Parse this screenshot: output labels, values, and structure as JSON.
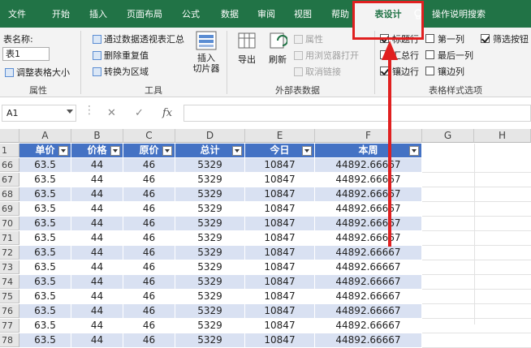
{
  "tabs": [
    "文件",
    "开始",
    "插入",
    "页面布局",
    "公式",
    "数据",
    "审阅",
    "视图",
    "帮助"
  ],
  "active_tab": "表设计",
  "tell_me": "操作说明搜索",
  "ribbon": {
    "properties": {
      "name_label": "表名称:",
      "name_value": "表1",
      "resize": "调整表格大小",
      "group": "属性"
    },
    "tools": {
      "pivot": "通过数据透视表汇总",
      "dedupe": "删除重复值",
      "convert": "转换为区域",
      "slicer": "插入\n切片器",
      "group": "工具"
    },
    "external": {
      "export": "导出",
      "refresh": "刷新",
      "properties": "属性",
      "open_browser": "用浏览器打开",
      "unlink": "取消链接",
      "group": "外部表数据"
    },
    "style_options": {
      "items": [
        {
          "label": "标题行",
          "checked": true
        },
        {
          "label": "第一列",
          "checked": false
        },
        {
          "label": "筛选按钮",
          "checked": true
        },
        {
          "label": "汇总行",
          "checked": false
        },
        {
          "label": "最后一列",
          "checked": false
        },
        {
          "label": "镶边行",
          "checked": true
        },
        {
          "label": "镶边列",
          "checked": false
        }
      ],
      "group": "表格样式选项"
    }
  },
  "formula_bar": {
    "name_box": "A1",
    "cancel": "✕",
    "enter": "✓",
    "fx": "fx",
    "formula": ""
  },
  "columns": [
    "A",
    "B",
    "C",
    "D",
    "E",
    "F",
    "G",
    "H"
  ],
  "headers": [
    "单价",
    "价格",
    "原价",
    "总计",
    "今日",
    "本周"
  ],
  "header_row_number": "1",
  "rows": [
    {
      "n": "66",
      "v": [
        "63.5",
        "44",
        "46",
        "5329",
        "10847",
        "44892.66667"
      ]
    },
    {
      "n": "67",
      "v": [
        "63.5",
        "44",
        "46",
        "5329",
        "10847",
        "44892.66667"
      ]
    },
    {
      "n": "68",
      "v": [
        "63.5",
        "44",
        "46",
        "5329",
        "10847",
        "44892.66667"
      ]
    },
    {
      "n": "69",
      "v": [
        "63.5",
        "44",
        "46",
        "5329",
        "10847",
        "44892.66667"
      ]
    },
    {
      "n": "70",
      "v": [
        "63.5",
        "44",
        "46",
        "5329",
        "10847",
        "44892.66667"
      ]
    },
    {
      "n": "71",
      "v": [
        "63.5",
        "44",
        "46",
        "5329",
        "10847",
        "44892.66667"
      ]
    },
    {
      "n": "72",
      "v": [
        "63.5",
        "44",
        "46",
        "5329",
        "10847",
        "44892.66667"
      ]
    },
    {
      "n": "73",
      "v": [
        "63.5",
        "44",
        "46",
        "5329",
        "10847",
        "44892.66667"
      ]
    },
    {
      "n": "74",
      "v": [
        "63.5",
        "44",
        "46",
        "5329",
        "10847",
        "44892.66667"
      ]
    },
    {
      "n": "75",
      "v": [
        "63.5",
        "44",
        "46",
        "5329",
        "10847",
        "44892.66667"
      ]
    },
    {
      "n": "76",
      "v": [
        "63.5",
        "44",
        "46",
        "5329",
        "10847",
        "44892.66667"
      ]
    },
    {
      "n": "77",
      "v": [
        "63.5",
        "44",
        "46",
        "5329",
        "10847",
        "44892.66667"
      ]
    },
    {
      "n": "78",
      "v": [
        "63.5",
        "44",
        "46",
        "5329",
        "10847",
        "44892.66667"
      ]
    }
  ],
  "colors": {
    "excel_green": "#217346",
    "table_header": "#4472c4",
    "band_row": "#d9e1f2",
    "annotation_red": "#e02020"
  }
}
